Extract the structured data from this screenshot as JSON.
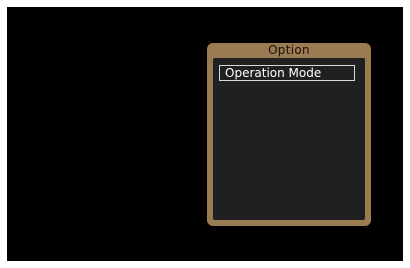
{
  "option_panel": {
    "title": "Option",
    "items": [
      {
        "label": "Operation Mode",
        "selected": true
      }
    ]
  },
  "colors": {
    "screen_background": "#000000",
    "panel_frame": "#9a7b52",
    "panel_body": "#202020",
    "selection_border": "#d9d9d9"
  }
}
